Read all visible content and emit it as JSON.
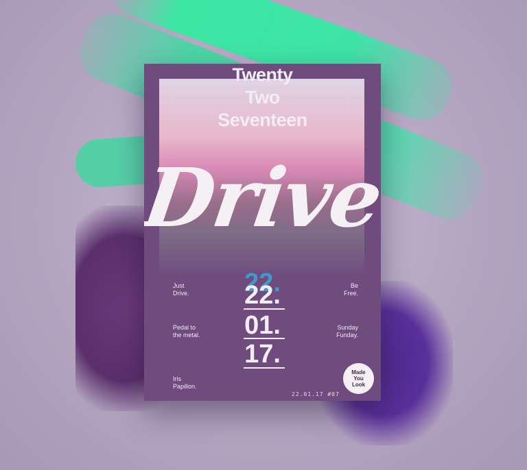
{
  "colors": {
    "background": "#b7a9c3",
    "accent_green": "#3ee6a4",
    "poster": "#6f4b7e"
  },
  "poster": {
    "title_lines": [
      "Twenty",
      "Two",
      "Seventeen"
    ],
    "headline": "Drive",
    "left_tagline": [
      "Just",
      "Drive."
    ],
    "right_tagline": [
      "Be",
      "Free."
    ],
    "left_mid": [
      "Pedal to",
      "the metal."
    ],
    "right_mid": [
      "Sunday",
      "Funday."
    ],
    "author": [
      "Iris",
      "Papillon."
    ],
    "date_lines": [
      "22.",
      "01.",
      "17."
    ],
    "badge": [
      "Made",
      "You",
      "Look"
    ],
    "footer": "22.01.17 #07"
  }
}
